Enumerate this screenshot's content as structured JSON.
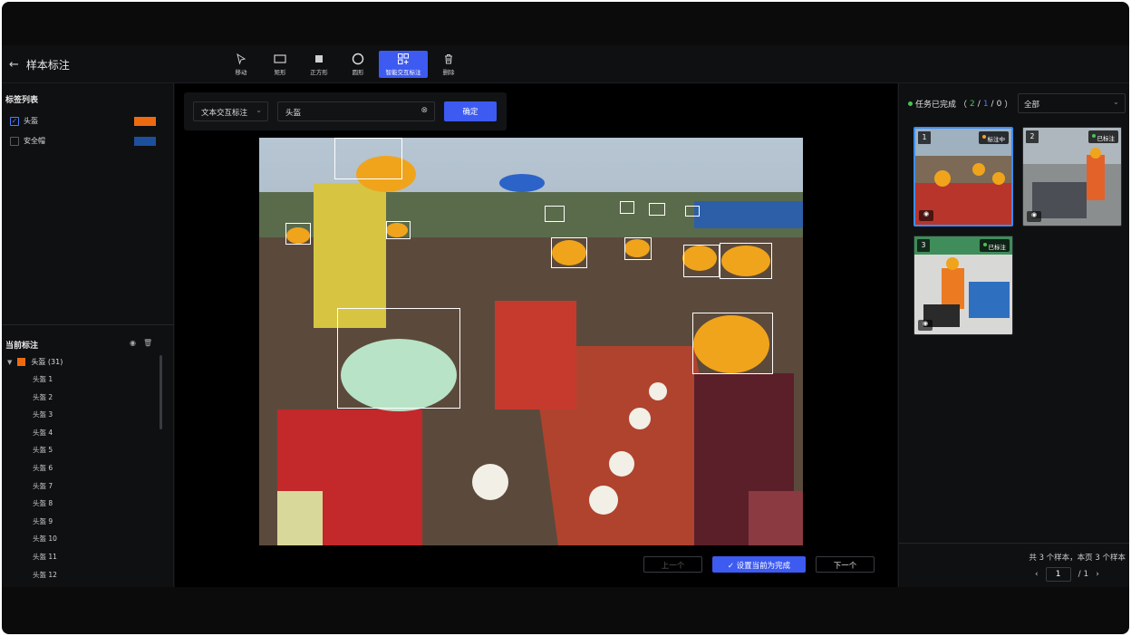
{
  "header": {
    "title": "样本标注",
    "tools": [
      {
        "label": "移动",
        "icon": "cursor-icon"
      },
      {
        "label": "矩形",
        "icon": "rectangle-icon"
      },
      {
        "label": "正方形",
        "icon": "square-icon"
      },
      {
        "label": "圆形",
        "icon": "circle-icon"
      },
      {
        "label": "智能交互标注",
        "icon": "smart-select-icon",
        "active": true
      },
      {
        "label": "删除",
        "icon": "trash-icon"
      }
    ]
  },
  "left": {
    "tag_list_title": "标签列表",
    "tags": [
      {
        "name": "头盔",
        "checked": true,
        "color": "#ee6a11"
      },
      {
        "name": "安全帽",
        "checked": false,
        "color": "#1d4f9c"
      }
    ],
    "current_title": "当前标注",
    "group": {
      "label": "头盔 (31)"
    },
    "annotations": [
      "头盔 1",
      "头盔 2",
      "头盔 3",
      "头盔 4",
      "头盔 5",
      "头盔 6",
      "头盔 7",
      "头盔 8",
      "头盔 9",
      "头盔 10",
      "头盔 11",
      "头盔 12"
    ]
  },
  "center": {
    "mode_select": "文本交互标注",
    "text_input": "头盔",
    "confirm": "确定",
    "prev": "上一个",
    "done": "设置当前为完成",
    "next": "下一个"
  },
  "right": {
    "status_label": "任务已完成",
    "status_done": "2",
    "status_total": "1",
    "status_zero": "0",
    "filter": "全部",
    "thumbs": [
      {
        "num": "1",
        "badge": "标注中",
        "badge_color": "#f5a623"
      },
      {
        "num": "2",
        "badge": "已标注",
        "badge_color": "#47c553"
      },
      {
        "num": "3",
        "badge": "已标注",
        "badge_color": "#47c553"
      }
    ],
    "total": "共 3 个样本，本页 3 个样本",
    "page": "1",
    "pages": "/ 1"
  }
}
